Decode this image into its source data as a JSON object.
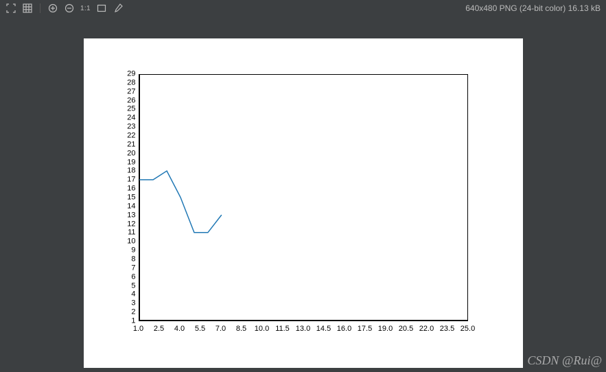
{
  "toolbar": {
    "status": "640x480 PNG (24-bit color) 16.13 kB",
    "one_to_one": "1:1"
  },
  "watermark": "CSDN @Rui@",
  "chart_data": {
    "type": "line",
    "x": [
      1,
      2,
      3,
      4,
      5,
      6,
      7
    ],
    "values": [
      17,
      17,
      18,
      15,
      11,
      11,
      13
    ],
    "xlim": [
      1.0,
      25.0
    ],
    "ylim": [
      1,
      29
    ],
    "x_ticks": [
      "1.0",
      "2.5",
      "4.0",
      "5.5",
      "7.0",
      "8.5",
      "10.0",
      "11.5",
      "13.0",
      "14.5",
      "16.0",
      "17.5",
      "19.0",
      "20.5",
      "22.0",
      "23.5",
      "25.0"
    ],
    "y_ticks": [
      1,
      2,
      3,
      4,
      5,
      6,
      7,
      8,
      9,
      10,
      11,
      12,
      13,
      14,
      15,
      16,
      17,
      18,
      19,
      20,
      21,
      22,
      23,
      24,
      25,
      26,
      27,
      28,
      29
    ],
    "line_color": "#1f77b4",
    "title": "",
    "xlabel": "",
    "ylabel": ""
  }
}
